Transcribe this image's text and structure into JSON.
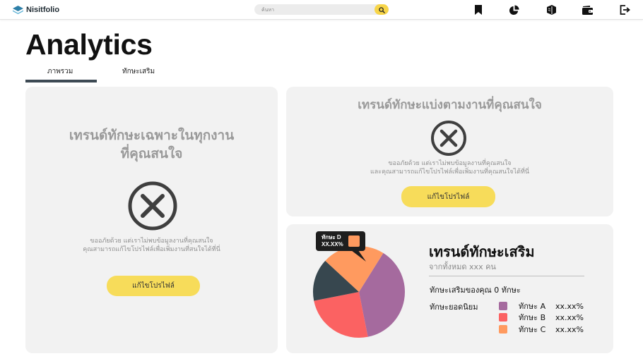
{
  "brand": {
    "name": "Nisitfolio"
  },
  "search": {
    "placeholder": "ค้นหา"
  },
  "nav": [
    "bookmark-icon",
    "pie-chart-icon",
    "books-icon",
    "wallet-icon",
    "logout-icon"
  ],
  "page": {
    "title": "Analytics"
  },
  "tabs": [
    {
      "label": "ภาพรวม",
      "active": true
    },
    {
      "label": "ทักษะเสริม",
      "active": false
    }
  ],
  "card_left": {
    "title_line1": "เทรนด์ทักษะเฉพาะในทุกงาน",
    "title_line2": "ที่คุณสนใจ",
    "msg_line1": "ขออภัยด้วย แต่เราไม่พบข้อมูลงานที่คุณสนใจ",
    "msg_line2": "คุณสามารถแก้ไขโปรไฟล์เพื่อเพิ่มงานที่สนใจได้ที่นี่",
    "button": "แก้ไขโปรไฟล์"
  },
  "card_right_top": {
    "title": "เทรนด์ทักษะแบ่งตามงานที่คุณสนใจ",
    "msg_line1": "ขออภัยด้วย แต่เราไม่พบข้อมูลงานที่คุณสนใจ",
    "msg_line2": "และคุณสามารถแก้ไขโปรไฟล์เพื่อเพิ่มงานที่คุณสนใจได้ที่นี่",
    "button": "แก้ไขโปรไฟล์"
  },
  "skills_card": {
    "title": "เทรนด์ทักษะเสริม",
    "subtitle": "จากทั้งหมด xxx คน",
    "your_skills": "ทักษะเสริมของคุณ 0 ทักษะ",
    "popular_label": "ทักษะยอดนิยม",
    "tooltip": {
      "name": "ทักษะ D",
      "value": "XX.XX%"
    },
    "legend": [
      {
        "name": "ทักษะ A",
        "value": "xx.xx%"
      },
      {
        "name": "ทักษะ B",
        "value": "xx.xx%"
      },
      {
        "name": "ทักษะ C",
        "value": "xx.xx%"
      }
    ]
  },
  "chart_data": {
    "type": "pie",
    "slices": [
      {
        "label": "ทักษะ A",
        "percent": 38,
        "color": "#a56a9e"
      },
      {
        "label": "ทักษะ B",
        "percent": 25,
        "color": "#fb6262"
      },
      {
        "label": "ทักษะ D",
        "percent": 15,
        "color": "#37474f"
      },
      {
        "label": "ทักษะ C",
        "percent": 22,
        "color": "#ff9a5f"
      }
    ]
  },
  "colors": {
    "accent_yellow": "#f7dc5a",
    "dark": "#3d4a54",
    "card_bg": "#f2f2f2"
  }
}
